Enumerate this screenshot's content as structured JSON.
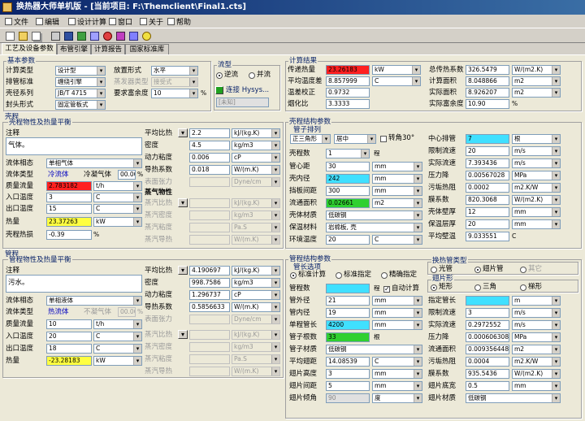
{
  "window": {
    "title": "换热器大师单机版 - [当前项目: F:\\Themclient\\Final1.cts]"
  },
  "menu": [
    {
      "label": "文件",
      "icon": "file-icon"
    },
    {
      "label": "编辑",
      "icon": "edit-icon"
    },
    {
      "label": "设计计算",
      "icon": "calc-icon"
    },
    {
      "label": "窗口",
      "icon": "window-icon"
    },
    {
      "label": "关于",
      "icon": "about-icon"
    },
    {
      "label": "帮助",
      "icon": "help-icon"
    }
  ],
  "tabs": [
    "工艺及设备参数",
    "布管引擎",
    "计算报告",
    "国家标准库"
  ],
  "basic": {
    "title": "基本参数",
    "calc_type_label": "计算类型",
    "calc_type": "设计型",
    "place_label": "放置形式",
    "place": "水平",
    "tube_std_label": "排管标准",
    "tube_std": "缠绕引擎",
    "cond_type_label": "蒸发器类型",
    "cond_type": "接受式",
    "shell_series_label": "壳径系列",
    "shell_series": "JB/T 4715",
    "margin_label": "要求富余度",
    "margin": "10",
    "margin_unit": "%",
    "head_label": "封头形式",
    "head": "固定管板式"
  },
  "flow": {
    "title": "流型",
    "counter": "逆流",
    "parallel": "并流",
    "connect": "连接 Hysys...",
    "unknown": "[未知]"
  },
  "results": {
    "title": "计算结果",
    "duty_label": "传递热量",
    "duty": "23.26183",
    "duty_unit": "kW",
    "lmtd_label": "平均温度差",
    "lmtd": "8.857999",
    "lmtd_unit": "C",
    "corr_label": "温差校正",
    "corr": "0.9732",
    "rod_label": "烟化比",
    "rod": "3.3333",
    "u_label": "总传热系数",
    "u": "326.5479",
    "u_unit": "W/(m2.K)",
    "area_label": "计算面积",
    "area": "8.048866",
    "area_unit": "m2",
    "aarea_label": "实际面积",
    "aarea": "8.926207",
    "aarea_unit": "m2",
    "over_label": "实际富余度",
    "over": "10.90",
    "over_unit": "%"
  },
  "shell_prop": {
    "group": "壳程",
    "title": "壳程物性及热量平衡",
    "note_label": "注释",
    "note": "气体。",
    "phase_label": "流体相态",
    "phase": "单相气体",
    "type_label": "流体类型",
    "type": "冷流体",
    "cond_label": "冷凝气体",
    "cond_pct": "00.00",
    "cond_unit": "%",
    "flow_label": "质量流量",
    "flow": "2.783182",
    "flow_unit": "t/h",
    "tin_label": "入口温度",
    "tin": "3",
    "tin_unit": "C",
    "tout_label": "出口温度",
    "tout": "15",
    "tout_unit": "C",
    "heat_label": "热量",
    "heat": "23.37263",
    "heat_unit": "kW",
    "loss_label": "壳程热损",
    "loss": "-0.39",
    "loss_unit": "%",
    "cp_label": "平均比热",
    "cp": "2.2",
    "cp_unit": "kJ/(kg.K)",
    "rho_label": "密度",
    "rho": "4.5",
    "rho_unit": "kg/m3",
    "mu_label": "动力粘度",
    "mu": "0.006",
    "mu_unit": "cP",
    "k_label": "导热系数",
    "k": "0.018",
    "k_unit": "W/(m.K)",
    "st_label": "表面张力",
    "st_unit": "Dyne/cm",
    "vap_label": "蒸气物性",
    "vcp_label": "蒸汽比热",
    "vcp_unit": "kJ/(kg.K)",
    "vrho_label": "蒸汽密度",
    "vrho_unit": "kg/m3",
    "vmu_label": "蒸汽粘度",
    "vmu_unit": "Pa.S",
    "vk_label": "蒸汽导热",
    "vk_unit": "W/(m.K)",
    "lh_label": "相变热",
    "lh_unit": "kJ/kg"
  },
  "shell_struct": {
    "title": "壳程结构参数",
    "tube_arr": "管子排列",
    "arr": "正三角形",
    "center": "居中",
    "rot_label": "转角30°",
    "ns_label": "壳程数",
    "ns": "1",
    "ns_unit": "程",
    "pitch_label": "管心距",
    "pitch": "30",
    "pitch_unit": "mm",
    "di_label": "壳内径",
    "di": "242",
    "di_unit": "mm",
    "baf_label": "挡板间距",
    "baf": "300",
    "baf_unit": "mm",
    "fa_label": "流通面积",
    "fa": "0.02661",
    "fa_unit": "m2",
    "mat_label": "壳体材质",
    "mat": "低碳钢",
    "ins_label": "保温材料",
    "ins": "岩棉板, 壳",
    "amb_label": "环境温度",
    "amb": "20",
    "amb_unit": "C",
    "v_label": "中心排管",
    "v": "7",
    "v_unit": "根",
    "vmax_label": "限制流速",
    "vmax": "20",
    "vmax_unit": "m/s",
    "va_label": "实际流速",
    "va": "7.393436",
    "va_unit": "m/s",
    "dp_label": "压力降",
    "dp": "0.00567028",
    "dp_unit": "MPa",
    "rf_label": "污垢热阻",
    "rf": "0.0002",
    "rf_unit": "m2.K/W",
    "h_label": "膜系数",
    "h": "820.3068",
    "h_unit": "W/(m2.K)",
    "wt_label": "壳体壁厚",
    "wt": "12",
    "wt_unit": "mm",
    "it_label": "保温层厚",
    "it": "20",
    "it_unit": "mm",
    "pw_label": "平均壁温",
    "pw": "9.033551",
    "pw_unit": "C"
  },
  "tube_prop": {
    "group": "管程",
    "title": "管程物性及热量平衡",
    "note_label": "注释",
    "note": "污水。",
    "phase_label": "流体相态",
    "phase": "单相液体",
    "type_label": "流体类型",
    "type": "热流体",
    "cond_label": "不凝气体",
    "cond_pct": "00.00",
    "cond_unit": "%",
    "flow_label": "质量流量",
    "flow": "10",
    "flow_unit": "t/h",
    "tin_label": "入口温度",
    "tin": "20",
    "tin_unit": "C",
    "tout_label": "出口温度",
    "tout": "18",
    "tout_unit": "C",
    "heat_label": "热量",
    "heat": "-23.28183",
    "heat_unit": "kW",
    "cp_label": "平均比热",
    "cp": "4.190697",
    "cp_unit": "kJ/(kg.K)",
    "rho_label": "密度",
    "rho": "998.7586",
    "rho_unit": "kg/m3",
    "mu_label": "动力粘度",
    "mu": "1.296737",
    "mu_unit": "cP",
    "k_label": "导热系数",
    "k": "0.5856633",
    "k_unit": "W/(m.K)",
    "st_label": "表面张力",
    "st_unit": "Dyne/cm",
    "vcp_label": "蒸汽比热",
    "vcp_unit": "kJ/(kg.K)",
    "vrho_label": "蒸汽密度",
    "vrho_unit": "kg/m3",
    "vmu_label": "蒸汽粘度",
    "vmu_unit": "Pa.S",
    "vk_label": "蒸汽导热",
    "vk_unit": "W/(m.K)",
    "lh_label": "相变热",
    "lh_unit": "kJ/kg"
  },
  "tube_struct": {
    "title": "管程结构参数",
    "len_opt": "管长选项",
    "std": "标准计算",
    "spec": "标准指定",
    "exact": "精确指定",
    "n_label": "管程数",
    "n_unit": "程",
    "auto": "自动计算",
    "od_label": "管外径",
    "od": "21",
    "od_unit": "mm",
    "id_label": "管内径",
    "id": "19",
    "id_unit": "mm",
    "len_label": "单程管长",
    "len": "4200",
    "len_unit": "mm",
    "cnt_label": "管子根数",
    "cnt": "33",
    "cnt_unit": "根",
    "mat_label": "管子材质",
    "mat": "低碳钢",
    "fp_label": "平均翅距",
    "fp": "14.08539",
    "fp_unit": "C",
    "fh_label": "翅片高度",
    "fh": "3",
    "fh_unit": "mm",
    "fs_label": "翅片间距",
    "fs": "5",
    "fs_unit": "mm",
    "fa_label": "翅片倾角",
    "fa": "90",
    "fa_unit": "度",
    "ftype": "换热管类型",
    "bare": "光管",
    "finned": "翅片管",
    "other": "其它",
    "fshape": "翅片形",
    "rect": "矩形",
    "tri": "三角",
    "trap": "梯形",
    "spl_label": "指定管长",
    "spl_unit": "m",
    "pl_label": "限制流速",
    "pl": "3",
    "pl_unit": "m/s",
    "va_label": "实际流速",
    "va": "0.2972552",
    "va_unit": "m/s",
    "dp_label": "压力降",
    "dp": "0.000606308",
    "dp_unit": "MPa",
    "fa2_label": "流通面积",
    "fa2": "0.009356448",
    "fa2_unit": "m2",
    "rf_label": "污垢热阻",
    "rf": "0.0004",
    "rf_unit": "m2.K/W",
    "h_label": "膜系数",
    "h": "935.5436",
    "h_unit": "W/(m2.K)",
    "fb_label": "翅片底宽",
    "fb": "0.5",
    "fb_unit": "mm",
    "fm_label": "翅片材质",
    "fm": "低碳钢"
  },
  "colors": {
    "cyan": "#40e0ff",
    "red": "#ff2020",
    "yellow": "#ffff40",
    "green": "#30d030"
  }
}
